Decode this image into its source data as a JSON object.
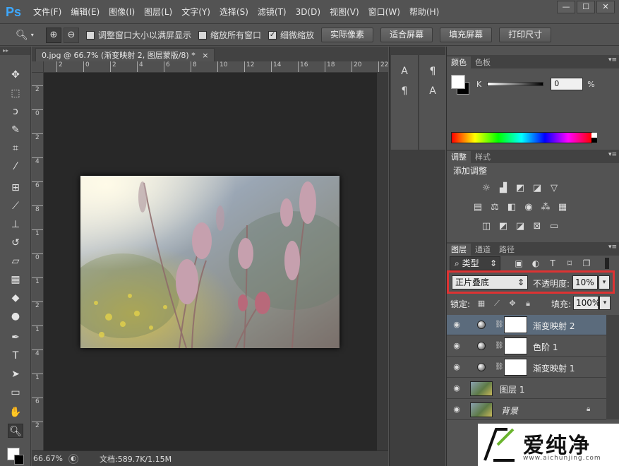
{
  "app": {
    "logo": "Ps",
    "menus": [
      "文件(F)",
      "编辑(E)",
      "图像(I)",
      "图层(L)",
      "文字(Y)",
      "选择(S)",
      "滤镜(T)",
      "3D(D)",
      "视图(V)",
      "窗口(W)",
      "帮助(H)"
    ],
    "window_controls": [
      "—",
      "☐",
      "✕"
    ]
  },
  "options": {
    "checkbox_resize": "调整窗口大小以满屏显示",
    "checkbox_all": "缩放所有窗口",
    "checkbox_scrubby": "细微缩放",
    "btn_actual": "实际像素",
    "btn_fit": "适合屏幕",
    "btn_fill": "填充屏幕",
    "btn_print": "打印尺寸"
  },
  "document": {
    "tab_title": "0.jpg @ 66.7% (渐变映射 2, 图层蒙版/8) *",
    "tab_close": "×",
    "ruler_h": [
      "2",
      "0",
      "2",
      "4",
      "6",
      "8",
      "10",
      "12",
      "14",
      "16",
      "18",
      "20",
      "22"
    ],
    "ruler_v": [
      "2",
      "0",
      "2",
      "4",
      "6",
      "8",
      "1",
      "0",
      "1",
      "2",
      "1",
      "4",
      "1",
      "6",
      "2"
    ],
    "zoom": "66.67%",
    "doc_size": "文档:589.7K/1.15M"
  },
  "color_panel": {
    "tabs": [
      "颜色",
      "色板"
    ],
    "channel_label": "K",
    "value": "0",
    "unit": "%"
  },
  "adjustments_panel": {
    "tabs": [
      "调整",
      "样式"
    ],
    "title": "添加调整"
  },
  "layers_panel": {
    "tabs": [
      "图层",
      "通道",
      "路径"
    ],
    "filter": "类型",
    "blend_mode": "正片叠底",
    "opacity_label": "不透明度:",
    "opacity_value": "10%",
    "lock_label": "锁定:",
    "fill_label": "填充:",
    "fill_value": "100%",
    "layers": [
      {
        "name": "渐变映射 2"
      },
      {
        "name": "色阶 1"
      },
      {
        "name": "渐变映射 1"
      },
      {
        "name": "图层 1"
      },
      {
        "name": "背景"
      }
    ]
  },
  "watermark": {
    "text": "爱纯净",
    "url": "www.aichunjing.com"
  }
}
